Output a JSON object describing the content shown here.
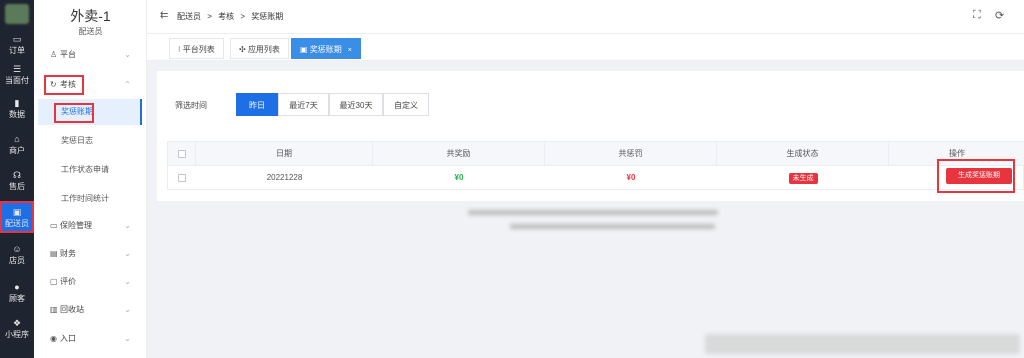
{
  "rail": {
    "items": [
      {
        "icon": "▭",
        "label": "订单"
      },
      {
        "icon": "☰",
        "label": "当面付"
      },
      {
        "icon": "▮",
        "label": "数据"
      },
      {
        "icon": "⌂",
        "label": "商户"
      },
      {
        "icon": "☊",
        "label": "售后"
      },
      {
        "icon": "▣",
        "label": "配送员"
      },
      {
        "icon": "☺",
        "label": "店员"
      },
      {
        "icon": "●",
        "label": "顾客"
      },
      {
        "icon": "❖",
        "label": "小程序"
      }
    ]
  },
  "sidebar": {
    "title": "外卖-1",
    "subtitle": "配送员",
    "menus": [
      {
        "icon": "♙",
        "label": "平台",
        "chev": "⌄"
      },
      {
        "icon": "↻",
        "label": "考核",
        "chev": "⌃"
      },
      {
        "icon": "▭",
        "label": "保险管理",
        "chev": "⌄"
      },
      {
        "icon": "▤",
        "label": "财务",
        "chev": "⌄"
      },
      {
        "icon": "▢",
        "label": "评价",
        "chev": "⌄"
      },
      {
        "icon": "▥",
        "label": "回收站",
        "chev": "⌄"
      },
      {
        "icon": "◉",
        "label": "入口",
        "chev": "⌄"
      }
    ],
    "subitems": [
      "奖惩账期",
      "奖惩日志",
      "工作状态申请",
      "工作时间统计"
    ]
  },
  "topbar": {
    "fold_icon": "⇇",
    "breadcrumb": [
      "配送员",
      ">",
      "考核",
      ">",
      "奖惩账期"
    ],
    "fullscreen_icon": "⛶",
    "refresh_icon": "⟳"
  },
  "tabs": [
    {
      "icon": "⁝",
      "label": "平台列表"
    },
    {
      "icon": "✣",
      "label": "应用列表"
    },
    {
      "icon": "▣",
      "label": "奖惩账期",
      "close": "×"
    }
  ],
  "filter": {
    "label": "筛选时间",
    "options": [
      "昨日",
      "最近7天",
      "最近30天",
      "自定义"
    ],
    "selected": "昨日"
  },
  "table": {
    "headers": [
      "日期",
      "共奖励",
      "共惩罚",
      "生成状态",
      "操作"
    ],
    "rows": [
      {
        "date": "20221228",
        "reward": "¥0",
        "penalty": "¥0",
        "status": "未生成",
        "action": "生成奖惩账期"
      }
    ]
  },
  "colors": {
    "accent": "#1e6fe6",
    "danger": "#e8343f",
    "success": "#22b14c",
    "rail": "#1f2530"
  }
}
